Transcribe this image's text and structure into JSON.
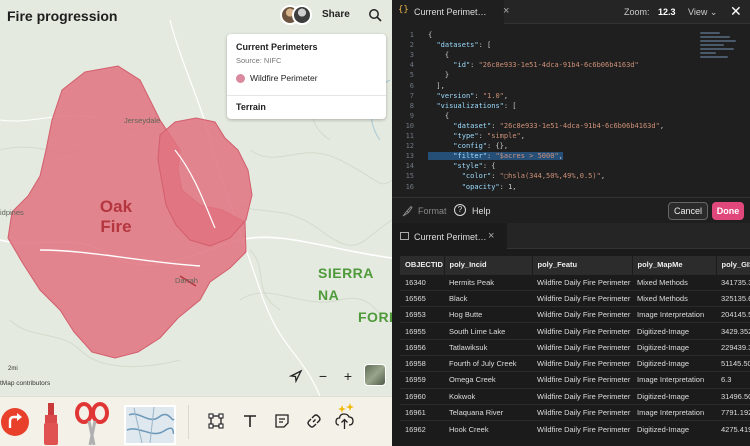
{
  "map": {
    "title": "Fire progression",
    "share_label": "Share",
    "labels": {
      "place_1": "Jerseydale",
      "place_2": "idpines",
      "place_3": "Darrah",
      "fire_line_1": "Oak",
      "fire_line_2": "Fire",
      "region_line_1": "SIERRA NA",
      "region_line_2": "FORE"
    },
    "scale_label": "2mi",
    "attribution": "tMap contributors",
    "fire_color": "#e0727f",
    "fire_label_color": "#b5363f",
    "region_label_color": "#4f9a3a"
  },
  "legend": {
    "title": "Current Perimeters",
    "source": "Source: NIFC",
    "item_label": "Wildfire Perimeter",
    "item_color": "#d98a9f",
    "terrain_label": "Terrain"
  },
  "toolbar": {
    "tools": [
      "arrow-turn-icon",
      "marker-icon",
      "scissors-icon",
      "map-sticker-icon",
      "bounding-box-icon",
      "text-icon",
      "note-icon",
      "link-icon",
      "upload-sparkle-icon"
    ]
  },
  "editor": {
    "tab_label": "Current Perimet…",
    "zoom_label": "Zoom:",
    "zoom_value": "12.3",
    "view_label": "View",
    "format_label": "Format",
    "help_label": "Help",
    "cancel_label": "Cancel",
    "done_label": "Done",
    "done_color": "#e0477a",
    "lines": [
      {
        "n": "1",
        "t": "{"
      },
      {
        "n": "2",
        "t": "  \"datasets\": ["
      },
      {
        "n": "3",
        "t": "    {"
      },
      {
        "n": "4",
        "t": "      \"id\": \"26c8e933-1e51-4dca-91b4-6c6b06b4163d\""
      },
      {
        "n": "5",
        "t": "    }"
      },
      {
        "n": "6",
        "t": "  ],"
      },
      {
        "n": "7",
        "t": "  \"version\": \"1.0\","
      },
      {
        "n": "8",
        "t": "  \"visualizations\": ["
      },
      {
        "n": "9",
        "t": "    {"
      },
      {
        "n": "10",
        "t": "      \"dataset\": \"26c8e933-1e51-4dca-91b4-6c6b06b4163d\","
      },
      {
        "n": "11",
        "t": "      \"type\": \"simple\","
      },
      {
        "n": "12",
        "t": "      \"config\": {},"
      },
      {
        "n": "13",
        "t": "      \"filter\": \"$acres > 5000\","
      },
      {
        "n": "14",
        "t": "      \"style\": {"
      },
      {
        "n": "15",
        "t": "        \"color\": \"▢hsla(344,50%,49%,0.5)\","
      },
      {
        "n": "16",
        "t": "        \"opacity\": 1,"
      }
    ],
    "highlight_line": "13"
  },
  "table": {
    "tab_label": "Current Perimet…",
    "columns": [
      "OBJECTID",
      "poly_Incid",
      "poly_Featu",
      "poly_MapMe",
      "poly_GISA"
    ],
    "rows": [
      [
        "16340",
        "Hermits Peak",
        "Wildfire Daily Fire Perimeter",
        "Mixed Methods",
        "341735.3"
      ],
      [
        "16565",
        "Black",
        "Wildfire Daily Fire Perimeter",
        "Mixed Methods",
        "325135.6"
      ],
      [
        "16953",
        "Hog Butte",
        "Wildfire Daily Fire Perimeter",
        "Image Interpretation",
        "204145.5"
      ],
      [
        "16955",
        "South Lime Lake",
        "Wildfire Daily Fire Perimeter",
        "Digitized-Image",
        "3429.352"
      ],
      [
        "16956",
        "Tatlawiksuk",
        "Wildfire Daily Fire Perimeter",
        "Digitized-Image",
        "229439.3"
      ],
      [
        "16958",
        "Fourth of July Creek",
        "Wildfire Daily Fire Perimeter",
        "Digitized-Image",
        "51145.50"
      ],
      [
        "16959",
        "Omega Creek",
        "Wildfire Daily Fire Perimeter",
        "Image Interpretation",
        "6.3"
      ],
      [
        "16960",
        "Kokwok",
        "Wildfire Daily Fire Perimeter",
        "Digitized-Image",
        "31496.50"
      ],
      [
        "16961",
        "Telaquana River",
        "Wildfire Daily Fire Perimeter",
        "Image Interpretation",
        "7791.192"
      ],
      [
        "16962",
        "Hook Creek",
        "Wildfire Daily Fire Perimeter",
        "Digitized-Image",
        "4275.419"
      ]
    ]
  }
}
